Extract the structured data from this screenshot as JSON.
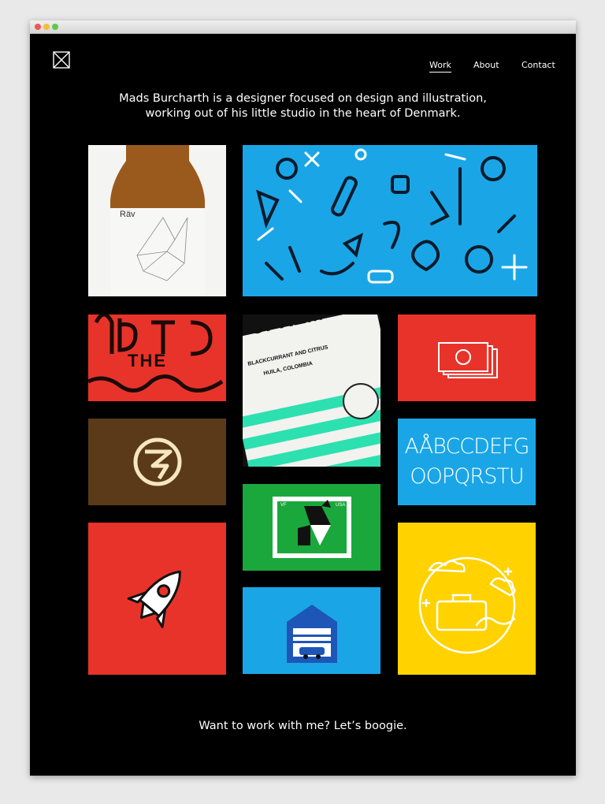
{
  "nav": {
    "items": [
      {
        "label": "Work",
        "active": true
      },
      {
        "label": "About",
        "active": false
      },
      {
        "label": "Contact",
        "active": false
      }
    ]
  },
  "intro": {
    "line1": "Mads Burcharth is a designer focused on design and illustration,",
    "line2": "working out of his little studio in the heart of Denmark."
  },
  "tiles": {
    "beer_label": "Räv",
    "typo_word": "THE",
    "coffee_headline": "UPREM",
    "coffee_sub1": "BLACKCURRANT AND CITRUS",
    "coffee_sub2": "HUILA, COLOMBIA",
    "alphabet_line1": "AÅBCCDEFG",
    "alphabet_line2": "OOPQRSTU",
    "stamp_left": "VF",
    "stamp_right": "USA"
  },
  "footer": {
    "text": "Want to work with me? Let’s boogie."
  },
  "colors": {
    "background": "#000000",
    "red": "#e8332a",
    "blue": "#1aa6e6",
    "brown": "#5a3a18",
    "green": "#1aa83c",
    "yellow": "#ffd200",
    "mint": "#2de0b0"
  }
}
